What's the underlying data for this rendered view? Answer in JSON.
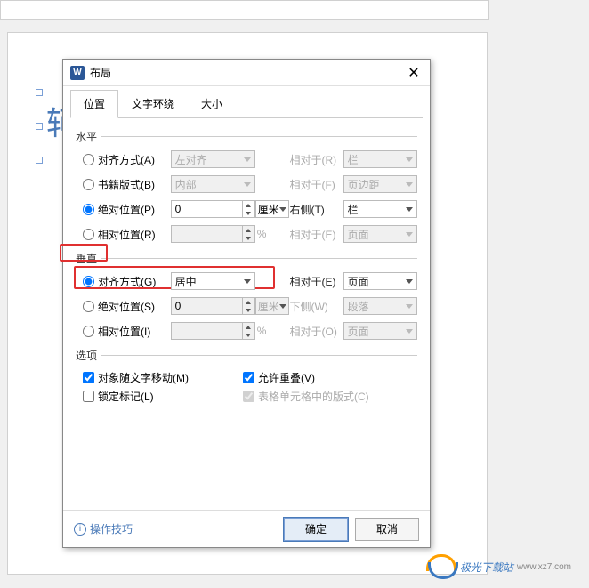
{
  "dialog": {
    "title": "布局",
    "tabs": [
      "位置",
      "文字环绕",
      "大小"
    ],
    "active_tab": 0
  },
  "horizontal": {
    "heading": "水平",
    "rows": {
      "align": {
        "label": "对齐方式(A)",
        "value": "左对齐",
        "rel_label": "相对于(R)",
        "rel_value": "栏"
      },
      "book": {
        "label": "书籍版式(B)",
        "value": "内部",
        "rel_label": "相对于(F)",
        "rel_value": "页边距"
      },
      "abs": {
        "label": "绝对位置(P)",
        "value": "0",
        "unit": "厘米",
        "rel_label": "右侧(T)",
        "rel_value": "栏"
      },
      "rel": {
        "label": "相对位置(R)",
        "value": "",
        "unit": "%",
        "rel_label": "相对于(E)",
        "rel_value": "页面"
      }
    }
  },
  "vertical": {
    "heading": "垂直",
    "rows": {
      "align": {
        "label": "对齐方式(G)",
        "value": "居中",
        "rel_label": "相对于(E)",
        "rel_value": "页面"
      },
      "abs": {
        "label": "绝对位置(S)",
        "value": "0",
        "unit": "厘米",
        "rel_label": "下侧(W)",
        "rel_value": "段落"
      },
      "rel": {
        "label": "相对位置(I)",
        "value": "",
        "unit": "%",
        "rel_label": "相对于(O)",
        "rel_value": "页面"
      }
    }
  },
  "options": {
    "heading": "选项",
    "move_with_text": "对象随文字移动(M)",
    "lock_anchor": "锁定标记(L)",
    "allow_overlap": "允许重叠(V)",
    "cell_layout": "表格单元格中的版式(C)"
  },
  "footer": {
    "help": "操作技巧",
    "ok": "确定",
    "cancel": "取消"
  },
  "bg_char": "轲",
  "watermark": {
    "text": "极光下载站",
    "sub": "www.xz7.com"
  }
}
